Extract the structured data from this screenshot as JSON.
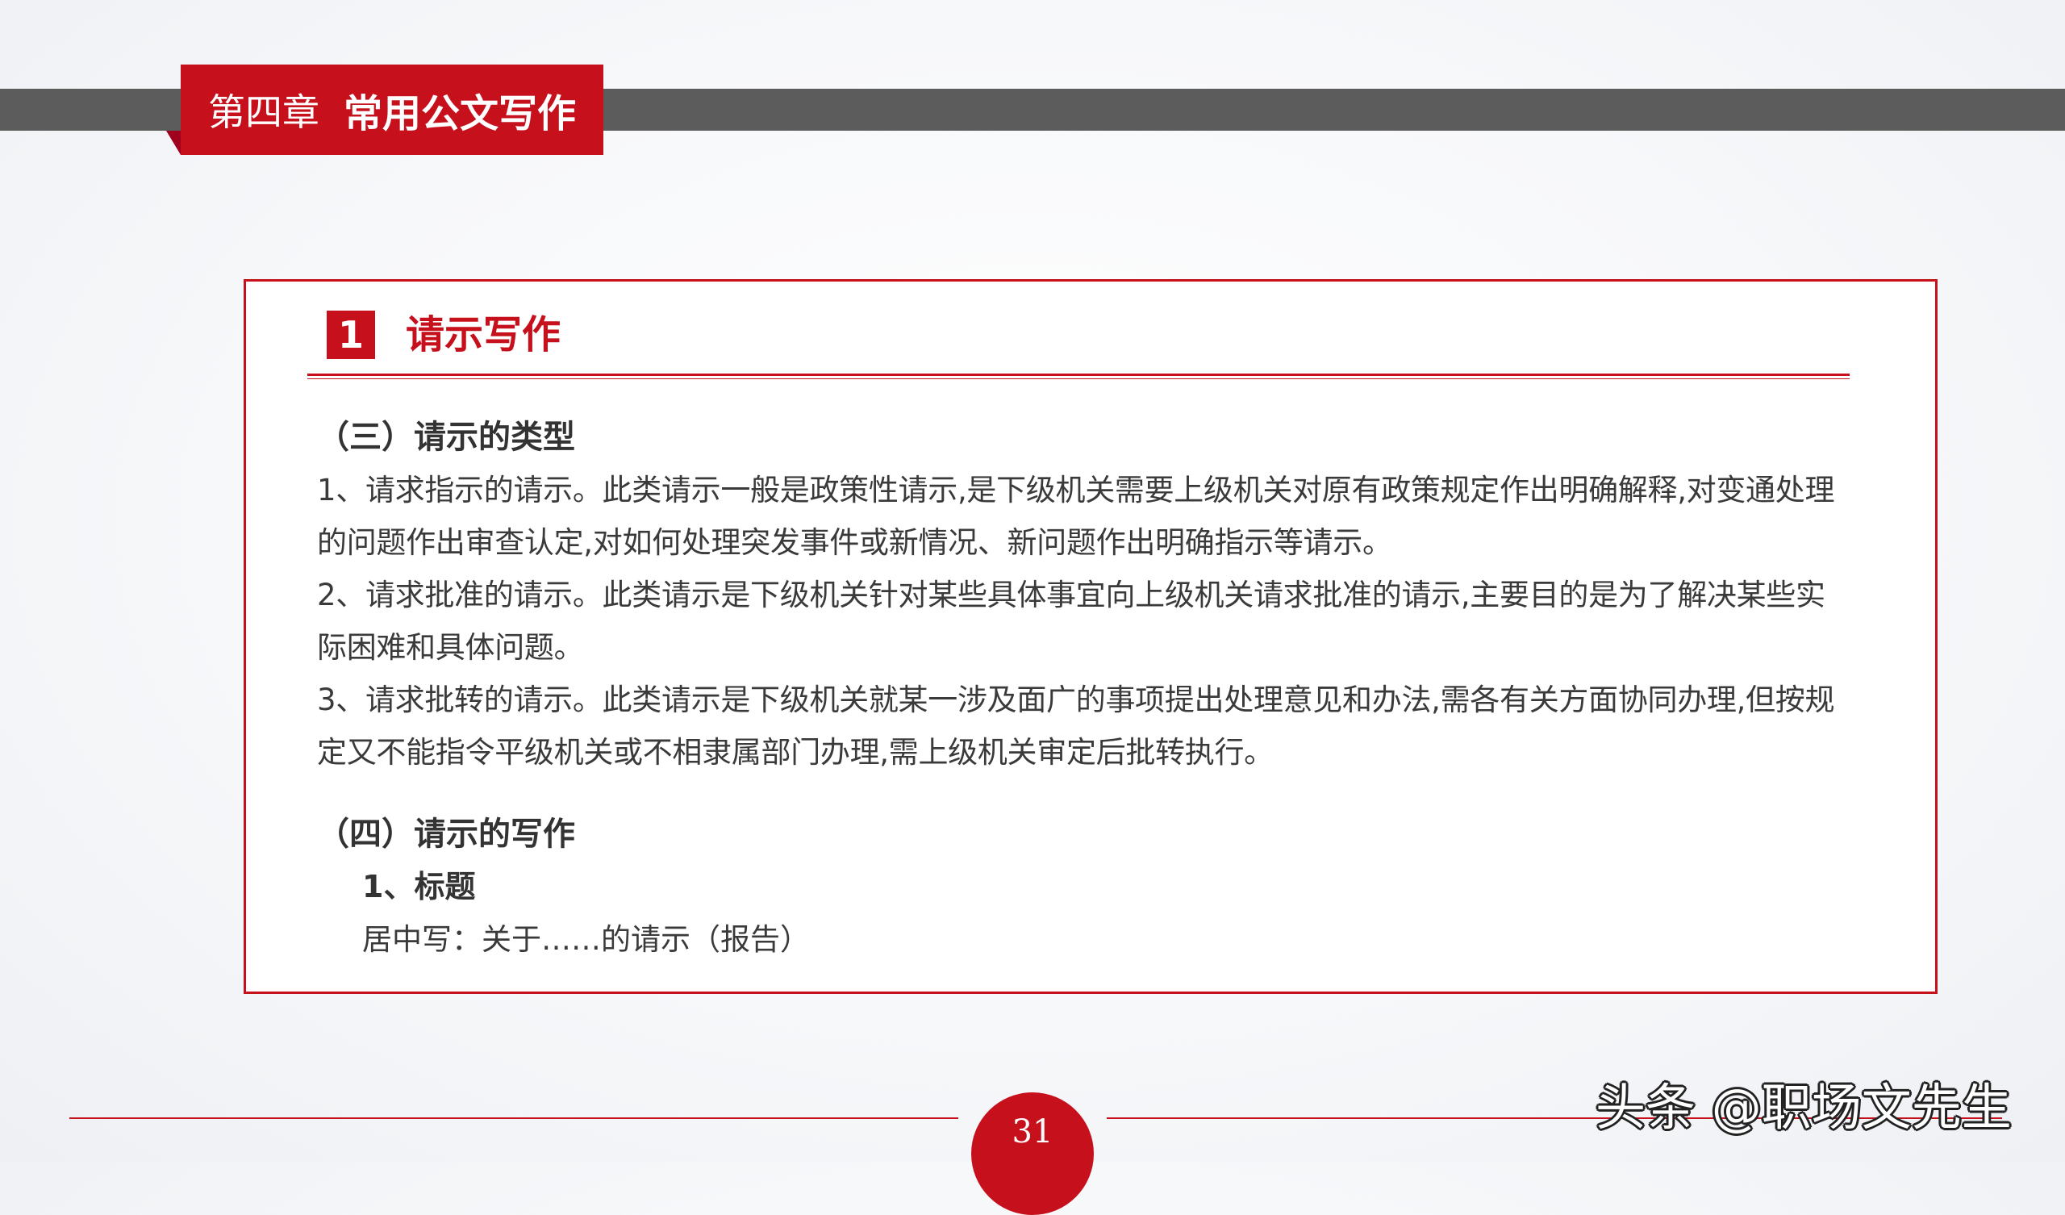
{
  "header": {
    "chapter_number": "第四章",
    "chapter_title": "常用公文写作"
  },
  "section": {
    "badge_number": "1",
    "title": "请示写作"
  },
  "content": {
    "part3_heading": "（三）请示的类型",
    "part3_paragraphs": [
      "1、请求指示的请示。此类请示一般是政策性请示,是下级机关需要上级机关对原有政策规定作出明确解释,对变通处理的问题作出审查认定,对如何处理突发事件或新情况、新问题作出明确指示等请示。",
      " 2、请求批准的请示。此类请示是下级机关针对某些具体事宜向上级机关请求批准的请示,主要目的是为了解决某些实际困难和具体问题。",
      " 3、请求批转的请示。此类请示是下级机关就某一涉及面广的事项提出处理意见和办法,需各有关方面协同办理,但按规定又不能指令平级机关或不相隶属部门办理,需上级机关审定后批转执行。"
    ],
    "part4_heading": "（四）请示的写作",
    "part4_subheading": "1、标题",
    "part4_text": "居中写：关于……的请示（报告）"
  },
  "footer": {
    "page_number": "31",
    "watermark": "头条 @职场文先生"
  },
  "colors": {
    "accent_red": "#c6111d",
    "band_gray": "#5c5c5c",
    "body_text": "#333333"
  }
}
